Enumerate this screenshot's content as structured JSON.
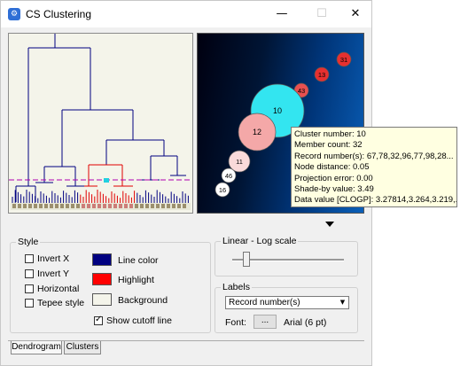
{
  "window": {
    "title": "CS Clustering",
    "icon": "cs-app-icon"
  },
  "titlebar": {
    "minimize": "—",
    "maximize": "☐",
    "close": "✕"
  },
  "dendrogram": {
    "line_color": "#000080",
    "highlight_color": "#e00000",
    "cutoff_color": "#b000b0"
  },
  "clusters_view": {
    "nodes": [
      {
        "label": "31",
        "fill": "#e63030"
      },
      {
        "label": "13",
        "fill": "#e63030"
      },
      {
        "label": "43",
        "fill": "#e85050"
      },
      {
        "label": "10",
        "fill": "#33e5f0"
      },
      {
        "label": "12",
        "fill": "#f4a8a8"
      },
      {
        "label": "11",
        "fill": "#fadada"
      },
      {
        "label": "46",
        "fill": "#ffffff"
      },
      {
        "label": "16",
        "fill": "#ffffff"
      }
    ]
  },
  "tooltip": {
    "lines": [
      "Cluster number: 10",
      "Member count: 32",
      "Record number(s): 67,78,32,96,77,98,28...",
      "Node distance: 0.05",
      "Projection error: 0.00",
      "Shade-by value: 3.49",
      "Data value [CLOGP]: 3.27814,3.264,3.219,..."
    ]
  },
  "style": {
    "legend": "Style",
    "invert_x": "Invert X",
    "invert_y": "Invert Y",
    "horizontal": "Horizontal",
    "tepee": "Tepee style",
    "line_color_label": "Line color",
    "highlight_label": "Highlight",
    "background_label": "Background",
    "show_cutoff": "Show cutoff line",
    "show_cutoff_checked": true,
    "colors": {
      "line": "#000080",
      "highlight": "#ff0000",
      "background": "#f4f4ea"
    }
  },
  "scale": {
    "legend": "Linear - Log scale",
    "level": 0.1
  },
  "labels": {
    "legend": "Labels",
    "select_value": "Record number(s)",
    "font_label": "Font:",
    "font_button": "...",
    "font_value": "Arial (6 pt)"
  },
  "tabs": [
    {
      "label": "Dendrogram",
      "active": true
    },
    {
      "label": "Clusters",
      "active": false
    }
  ]
}
